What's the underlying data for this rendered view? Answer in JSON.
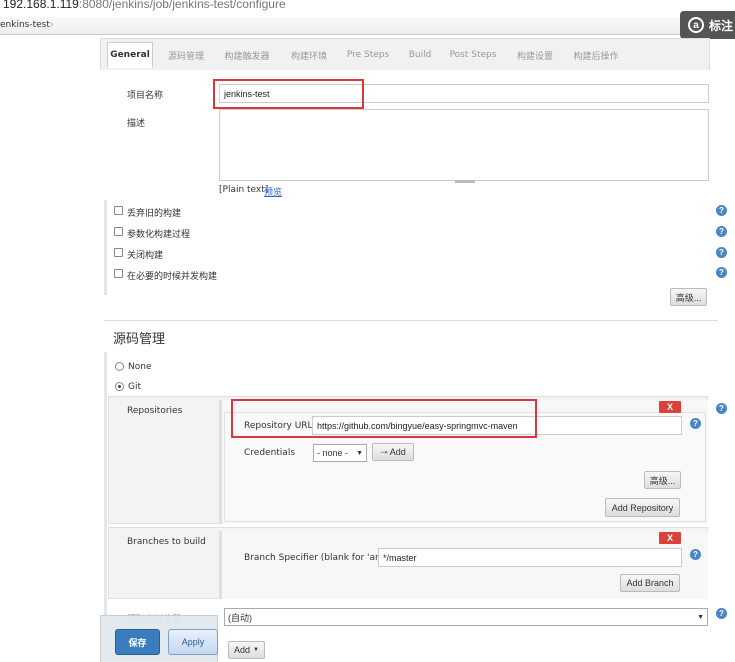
{
  "browser": {
    "url_host": "192.168.1.119",
    "url_rest": ":8080/jenkins/job/jenkins-test/configure",
    "breadcrumb": "enkins-test",
    "breadcrumb_arrow": "›",
    "annotation_label": "标注",
    "annotation_icon": "a"
  },
  "tabs": [
    {
      "label": "General"
    },
    {
      "label": "源码管理"
    },
    {
      "label": "构建触发器"
    },
    {
      "label": "构建环境"
    },
    {
      "label": "Pre Steps"
    },
    {
      "label": "Build"
    },
    {
      "label": "Post Steps"
    },
    {
      "label": "构建设置"
    },
    {
      "label": "构建后操作"
    }
  ],
  "general": {
    "project_name_label": "项目名称",
    "project_name_value": "jenkins-test",
    "description_label": "描述",
    "description_value": "",
    "plain_text": "[Plain text]",
    "preview_link": "预览",
    "options": [
      {
        "label": "丢弃旧的构建"
      },
      {
        "label": "参数化构建过程"
      },
      {
        "label": "关闭构建"
      },
      {
        "label": "在必要的时候并发构建"
      }
    ],
    "advanced_button": "高级..."
  },
  "scm": {
    "title": "源码管理",
    "options": [
      {
        "label": "None",
        "selected": false
      },
      {
        "label": "Git",
        "selected": true
      }
    ],
    "repositories_label": "Repositories",
    "repo_url_label": "Repository URL",
    "repo_url_value": "https://github.com/bingyue/easy-springmvc-maven",
    "credentials_label": "Credentials",
    "credentials_value": "- none -",
    "add_button": "Add",
    "advanced_button": "高级...",
    "add_repository_button": "Add Repository",
    "branches_label": "Branches to build",
    "branch_specifier_label": "Branch Specifier (blank for 'any')",
    "branch_specifier_value": "*/master",
    "add_branch_button": "Add Branch",
    "remove_label": "X",
    "repo_browser_label": "源码库浏览器",
    "repo_browser_value": "(自动)",
    "additional_add_button": "Add"
  },
  "footer": {
    "save_button": "保存",
    "apply_button": "Apply"
  },
  "colors": {
    "accent": "#3a7dbf",
    "highlight": "#d9363e",
    "help": "#4a86c6"
  }
}
